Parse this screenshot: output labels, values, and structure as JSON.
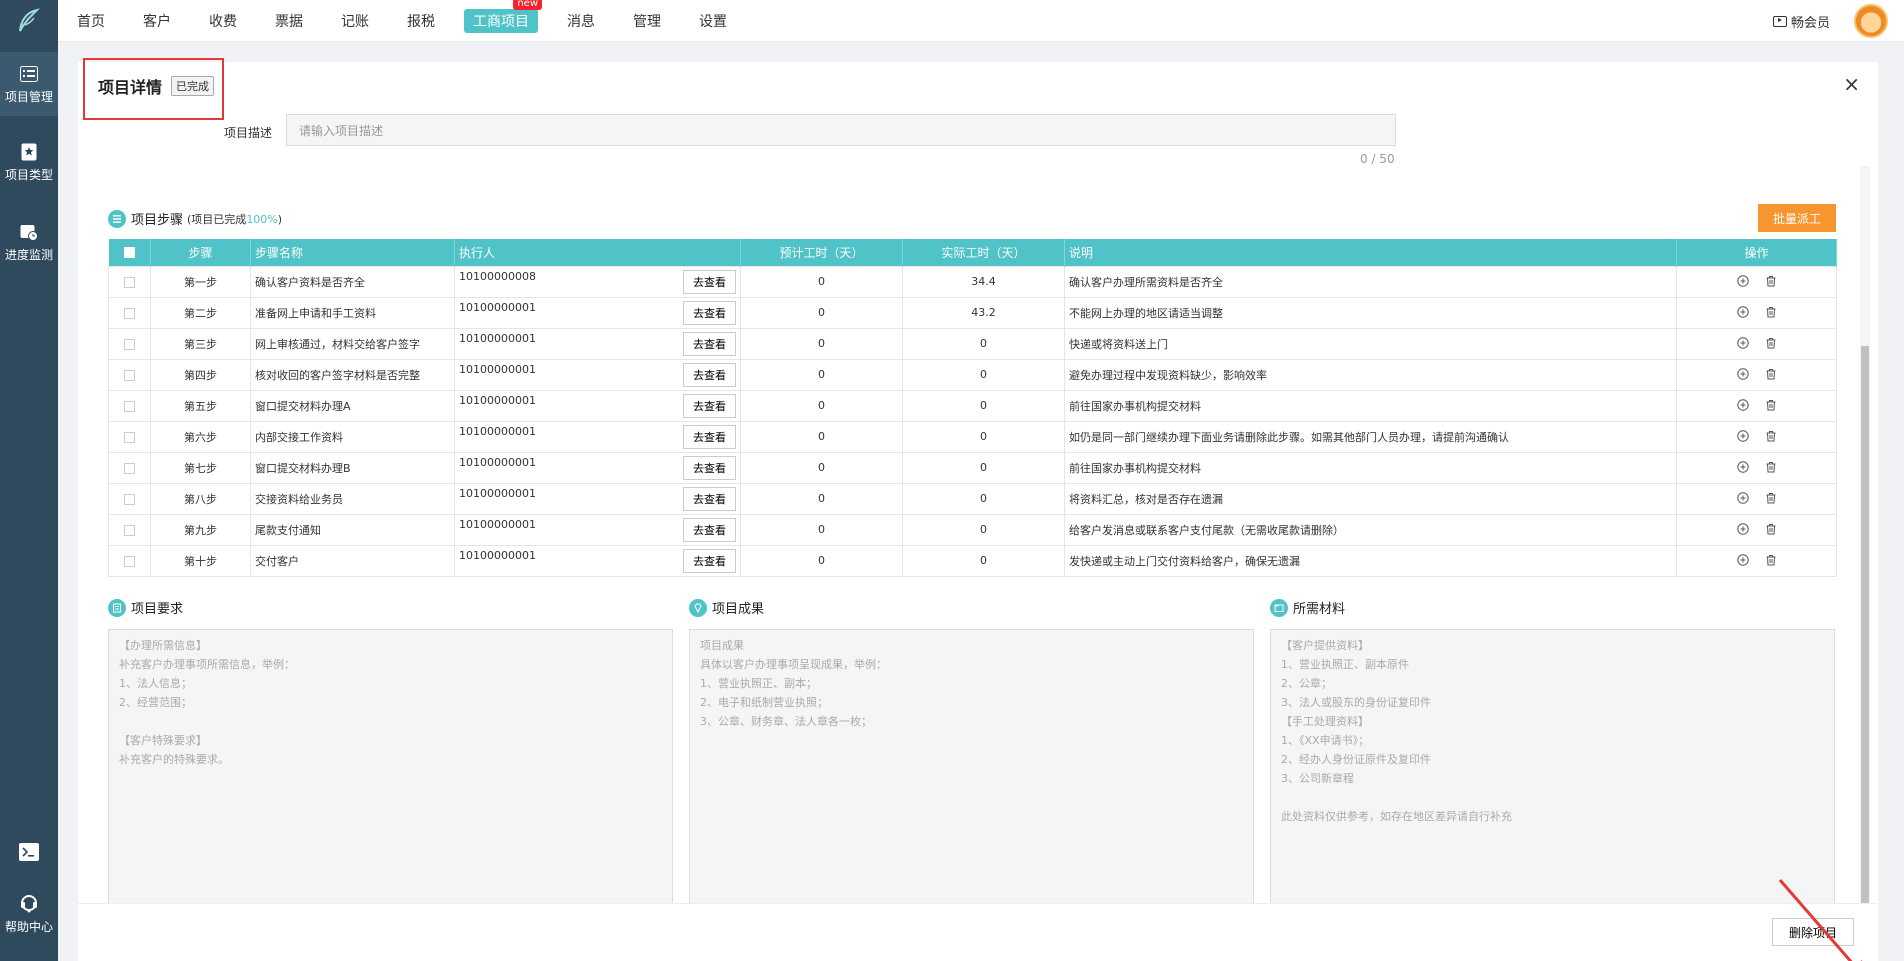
{
  "nav": {
    "items": [
      {
        "label": "首页"
      },
      {
        "label": "客户"
      },
      {
        "label": "收费"
      },
      {
        "label": "票据"
      },
      {
        "label": "记账"
      },
      {
        "label": "报税"
      },
      {
        "label": "工商项目"
      },
      {
        "label": "消息"
      },
      {
        "label": "管理"
      },
      {
        "label": "设置"
      }
    ],
    "active_index": 6,
    "new_badge": "new",
    "member_label": "畅会员"
  },
  "sidebar": {
    "items": [
      {
        "label": "项目管理"
      },
      {
        "label": "项目类型"
      },
      {
        "label": "进度监测"
      }
    ],
    "help_label": "帮助中心"
  },
  "detail": {
    "title": "项目详情",
    "status": "已完成",
    "desc_label": "项目描述",
    "desc_placeholder": "请输入项目描述",
    "desc_count": "0 / 50"
  },
  "steps": {
    "section_title": "项目步骤",
    "progress_prefix": "(项目已完成",
    "progress_pct": "100%",
    "progress_suffix": ")",
    "batch_button": "批量派工",
    "goto_label": "去查看",
    "headers": [
      "步骤",
      "步骤名称",
      "执行人",
      "预计工时（天）",
      "实际工时（天）",
      "说明",
      "操作"
    ],
    "rows": [
      {
        "step": "第一步",
        "name": "确认客户资料是否齐全",
        "executor": "10100000008",
        "planned": "0",
        "actual": "34.4",
        "note": "确认客户办理所需资料是否齐全"
      },
      {
        "step": "第二步",
        "name": "准备网上申请和手工资料",
        "executor": "10100000001",
        "planned": "0",
        "actual": "43.2",
        "note": "不能网上办理的地区请适当调整"
      },
      {
        "step": "第三步",
        "name": "网上审核通过，材料交给客户签字",
        "executor": "10100000001",
        "planned": "0",
        "actual": "0",
        "note": "快递或将资料送上门"
      },
      {
        "step": "第四步",
        "name": "核对收回的客户签字材料是否完整",
        "executor": "10100000001",
        "planned": "0",
        "actual": "0",
        "note": "避免办理过程中发现资料缺少，影响效率"
      },
      {
        "step": "第五步",
        "name": "窗口提交材料办理A",
        "executor": "10100000001",
        "planned": "0",
        "actual": "0",
        "note": "前往国家办事机构提交材料"
      },
      {
        "step": "第六步",
        "name": "内部交接工作资料",
        "executor": "10100000001",
        "planned": "0",
        "actual": "0",
        "note": "如仍是同一部门继续办理下面业务请删除此步骤。如需其他部门人员办理，请提前沟通确认"
      },
      {
        "step": "第七步",
        "name": "窗口提交材料办理B",
        "executor": "10100000001",
        "planned": "0",
        "actual": "0",
        "note": "前往国家办事机构提交材料"
      },
      {
        "step": "第八步",
        "name": "交接资料给业务员",
        "executor": "10100000001",
        "planned": "0",
        "actual": "0",
        "note": "将资料汇总，核对是否存在遗漏"
      },
      {
        "step": "第九步",
        "name": "尾款支付通知",
        "executor": "10100000001",
        "planned": "0",
        "actual": "0",
        "note": "给客户发消息或联系客户支付尾款（无需收尾款请删除）"
      },
      {
        "step": "第十步",
        "name": "交付客户",
        "executor": "10100000001",
        "planned": "0",
        "actual": "0",
        "note": "发快递或主动上门交付资料给客户，确保无遗漏"
      }
    ]
  },
  "requirements": {
    "title": "项目要求",
    "text": "【办理所需信息】\n补充客户办理事项所需信息，举例：\n1、法人信息；\n2、经营范围；\n\n【客户特殊要求】\n补充客户的特殊要求。"
  },
  "results": {
    "title": "项目成果",
    "text": "项目成果\n具体以客户办理事项呈现成果，举例：\n1、营业执照正、副本；\n2、电子和纸制营业执照；\n3、公章、财务章、法人章各一枚；"
  },
  "materials": {
    "title": "所需材料",
    "text": "【客户提供资料】\n1、营业执照正、副本原件\n2、公章；\n3、法人或股东的身份证复印件\n【手工处理资料】\n1、《XX申请书》；\n2、经办人身份证原件及复印件\n3、公司新章程\n\n此处资料仅供参考，如存在地区差异请自行补充"
  },
  "footer": {
    "delete_button": "删除项目"
  },
  "colors": {
    "accent": "#4fc3c8",
    "sidebar": "#2f4a5d",
    "batch": "#f7962f",
    "highlight": "#e53935"
  }
}
